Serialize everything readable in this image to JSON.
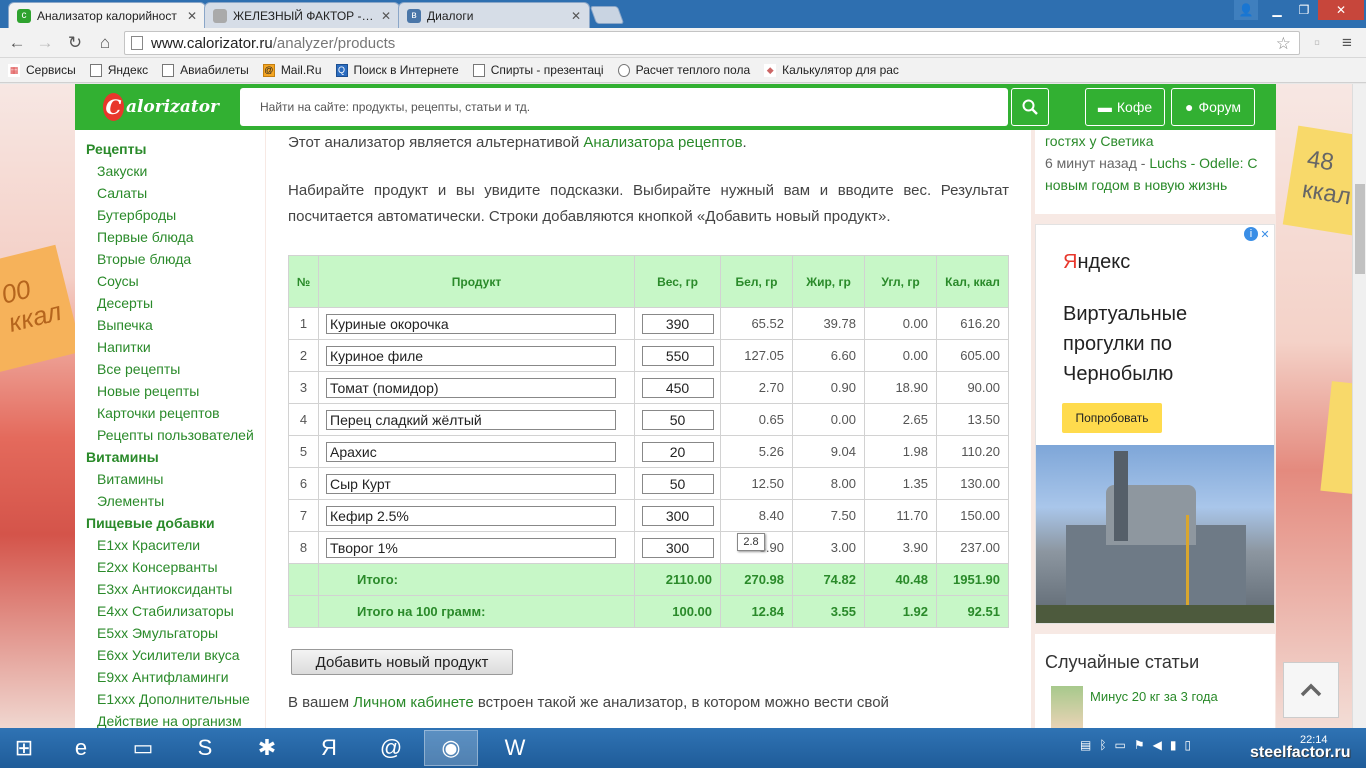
{
  "browser": {
    "tabs": [
      {
        "title": "Анализатор калорийност",
        "active": true
      },
      {
        "title": "ЖЕЛЕЗНЫЙ ФАКТОР - лу",
        "active": false
      },
      {
        "title": "Диалоги",
        "active": false
      }
    ],
    "url_host": "www.calorizator.ru",
    "url_path": "/analyzer/products",
    "bookmarks": [
      "Сервисы",
      "Яндекс",
      "Авиабилеты",
      "Mail.Ru",
      "Поиск в Интернете",
      "Спирты - презентаці",
      "Расчет теплого пола",
      "Калькулятор для рас"
    ]
  },
  "header": {
    "logo_text": "alorizator",
    "search_placeholder": "Найти на сайте: продукты, рецепты, статьи и тд.",
    "coffee_label": "Кофе",
    "forum_label": "Форум"
  },
  "sidebar": {
    "sections": [
      {
        "title": "Рецепты",
        "items": [
          "Закуски",
          "Салаты",
          "Бутерброды",
          "Первые блюда",
          "Вторые блюда",
          "Соусы",
          "Десерты",
          "Выпечка",
          "Напитки",
          "Все рецепты",
          "Новые рецепты",
          "Карточки рецептов",
          "Рецепты пользователей"
        ]
      },
      {
        "title": "Витамины",
        "items": [
          "Витамины",
          "Элементы"
        ]
      },
      {
        "title": "Пищевые добавки",
        "items": [
          "E1xx Красители",
          "E2xx Консерванты",
          "E3xx Антиоксиданты",
          "E4xx Стабилизаторы",
          "E5xx Эмульгаторы",
          "E6xx Усилители вкуса",
          "E9xx Антифламинги",
          "E1xxx Дополнительные",
          "Действие на организм"
        ]
      }
    ]
  },
  "main": {
    "intro_text": "Этот анализатор является альтернативой ",
    "intro_link": "Анализатора рецептов",
    "intro_end": ".",
    "hint": "Набирайте продукт и вы увидите подсказки. Выбирайте нужный вам и вводите вес. Результат посчитается автоматически. Строки добавляются кнопкой «Добавить новый продукт».",
    "table": {
      "headers": [
        "№",
        "Продукт",
        "Вес, гр",
        "Бел, гр",
        "Жир, гр",
        "Угл, гр",
        "Кал, ккал"
      ],
      "rows": [
        {
          "n": "1",
          "product": "Куриные окорочка",
          "weight": "390",
          "protein": "65.52",
          "fat": "39.78",
          "carbs": "0.00",
          "kcal": "616.20"
        },
        {
          "n": "2",
          "product": "Куриное филе",
          "weight": "550",
          "protein": "127.05",
          "fat": "6.60",
          "carbs": "0.00",
          "kcal": "605.00"
        },
        {
          "n": "3",
          "product": "Томат (помидор)",
          "weight": "450",
          "protein": "2.70",
          "fat": "0.90",
          "carbs": "18.90",
          "kcal": "90.00"
        },
        {
          "n": "4",
          "product": "Перец сладкий жёлтый",
          "weight": "50",
          "protein": "0.65",
          "fat": "0.00",
          "carbs": "2.65",
          "kcal": "13.50"
        },
        {
          "n": "5",
          "product": "Арахис",
          "weight": "20",
          "protein": "5.26",
          "fat": "9.04",
          "carbs": "1.98",
          "kcal": "110.20"
        },
        {
          "n": "6",
          "product": "Сыр Курт",
          "weight": "50",
          "protein": "12.50",
          "fat": "8.00",
          "carbs": "1.35",
          "kcal": "130.00"
        },
        {
          "n": "7",
          "product": "Кефир 2.5%",
          "weight": "300",
          "protein": "8.40",
          "fat": "7.50",
          "carbs": "11.70",
          "kcal": "150.00"
        },
        {
          "n": "8",
          "product": "Творог 1%",
          "weight": "300",
          "protein": "3.90",
          "fat": "3.00",
          "carbs": "3.90",
          "kcal": "237.00"
        }
      ],
      "total": {
        "label": "Итого:",
        "weight": "2110.00",
        "protein": "270.98",
        "fat": "74.82",
        "carbs": "40.48",
        "kcal": "1951.90"
      },
      "per100": {
        "label": "Итого на 100 грамм:",
        "weight": "100.00",
        "protein": "12.84",
        "fat": "3.55",
        "carbs": "1.92",
        "kcal": "92.51"
      }
    },
    "tooltip": "2.8",
    "add_button": "Добавить новый продукт",
    "cabinet_text_1": "В вашем ",
    "cabinet_link": "Личном кабинете",
    "cabinet_text_2": " встроен такой же анализатор, в котором можно вести свой"
  },
  "right": {
    "activity_line1": "гостях у Светика",
    "activity_time": "6 минут назад - ",
    "activity_user": "Luchs",
    "activity_sep": " - ",
    "activity_post": "Odelle: С новым годом в новую жизнь",
    "ad": {
      "brand_y": "Я",
      "brand_rest": "ндекс",
      "text": "Виртуальные прогулки по Чернобылю",
      "button": "Попробовать"
    },
    "articles_title": "Случайные статьи",
    "article_link": "Минус 20 кг за 3 года"
  },
  "decor": {
    "sticky_left": "00 ккал",
    "sticky_right": "48 ккал"
  },
  "taskbar": {
    "time": "22:14",
    "watermark": "steelfactor.ru"
  },
  "colors": {
    "brand_green": "#32b032",
    "link_green": "#2a8a2a",
    "table_header_bg": "#c7f7c7"
  }
}
